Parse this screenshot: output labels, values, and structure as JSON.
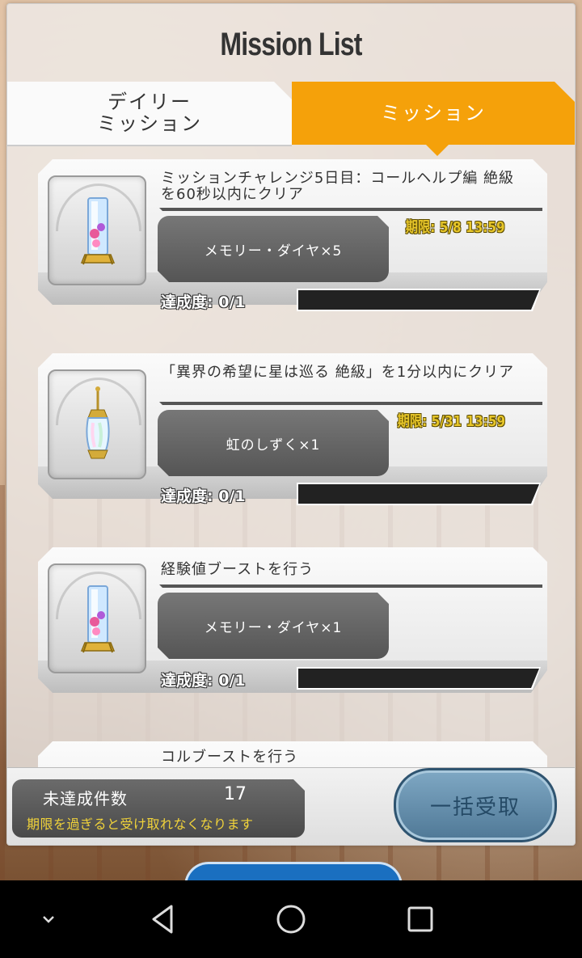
{
  "header": {
    "title": "Mission List"
  },
  "tabs": [
    {
      "label_line1": "デイリー",
      "label_line2": "ミッション",
      "active": false
    },
    {
      "label": "ミッション",
      "active": true
    }
  ],
  "missions": [
    {
      "title": "ミッションチャレンジ5日目：コールヘルプ編 絶級を60秒以内にクリア",
      "reward": "メモリー・ダイヤ×5",
      "deadline": "期限: 5/8 13:59",
      "progress_label": "達成度: 0/1",
      "progress": 0,
      "icon": "memory-diamond-icon"
    },
    {
      "title": "「異界の希望に星は巡る 絶級」を1分以内にクリア",
      "reward": "虹のしずく×1",
      "deadline": "期限: 5/31 13:59",
      "progress_label": "達成度: 0/1",
      "progress": 0,
      "icon": "rainbow-drop-icon"
    },
    {
      "title": "経験値ブーストを行う",
      "reward": "メモリー・ダイヤ×1",
      "deadline": "",
      "progress_label": "達成度: 0/1",
      "progress": 0,
      "icon": "memory-diamond-icon"
    },
    {
      "title": "コルブーストを行う",
      "reward": "",
      "deadline": "",
      "progress_label": "",
      "progress": 0,
      "icon": "memory-diamond-icon"
    }
  ],
  "footer": {
    "pending_label": "未達成件数",
    "pending_count": "17",
    "note": "期限を過ぎると受け取れなくなります",
    "bulk_receive": "一括受取"
  },
  "colors": {
    "accent": "#f5a10a",
    "deadline": "#e7c62a",
    "bulk_button": "#6a93b2"
  }
}
